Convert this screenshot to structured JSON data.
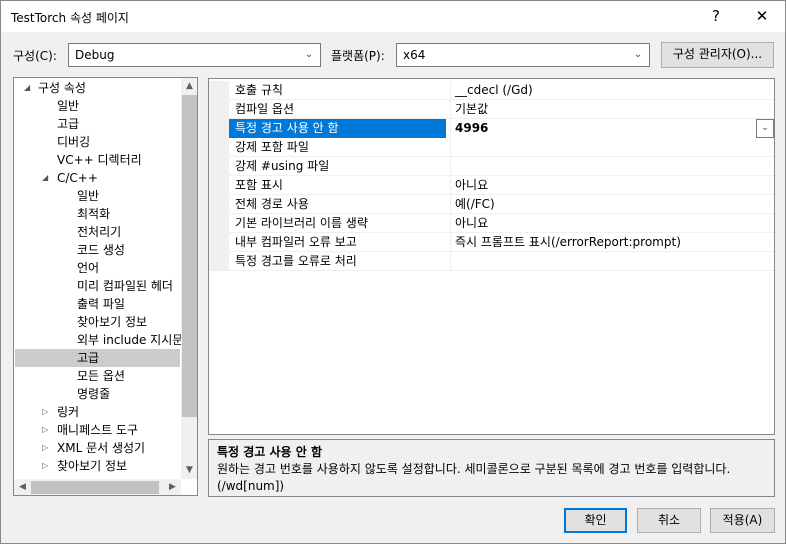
{
  "window": {
    "title": "TestTorch 속성 페이지",
    "help_glyph": "?",
    "close_glyph": "✕"
  },
  "config_bar": {
    "config_label": "구성(C):",
    "config_value": "Debug",
    "platform_label": "플랫폼(P):",
    "platform_value": "x64",
    "manager_button": "구성 관리자(O)..."
  },
  "tree": {
    "root": "구성 속성",
    "items": [
      {
        "label": "일반"
      },
      {
        "label": "고급"
      },
      {
        "label": "디버깅"
      },
      {
        "label": "VC++ 디렉터리"
      }
    ],
    "cpp_label": "C/C++",
    "cpp_items": [
      {
        "label": "일반"
      },
      {
        "label": "최적화"
      },
      {
        "label": "전처리기"
      },
      {
        "label": "코드 생성"
      },
      {
        "label": "언어"
      },
      {
        "label": "미리 컴파일된 헤더"
      },
      {
        "label": "출력 파일"
      },
      {
        "label": "찾아보기 정보"
      },
      {
        "label": "외부 include 지시문"
      },
      {
        "label": "고급"
      },
      {
        "label": "모든 옵션"
      },
      {
        "label": "명령줄"
      }
    ],
    "collapsed": [
      {
        "label": "링커"
      },
      {
        "label": "매니페스트 도구"
      },
      {
        "label": "XML 문서 생성기"
      },
      {
        "label": "찾아보기 정보"
      }
    ],
    "selected": "고급"
  },
  "properties": [
    {
      "name": "호출 규칙",
      "value": "__cdecl (/Gd)"
    },
    {
      "name": "컴파일 옵션",
      "value": "기본값"
    },
    {
      "name": "특정 경고 사용 안 함",
      "value": "4996"
    },
    {
      "name": "강제 포함 파일",
      "value": ""
    },
    {
      "name": "강제 #using 파일",
      "value": ""
    },
    {
      "name": "포함 표시",
      "value": "아니요"
    },
    {
      "name": "전체 경로 사용",
      "value": "예(/FC)"
    },
    {
      "name": "기본 라이브러리 이름 생략",
      "value": "아니요"
    },
    {
      "name": "내부 컴파일러 오류 보고",
      "value": "즉시 프롬프트 표시(/errorReport:prompt)"
    },
    {
      "name": "특정 경고를 오류로 처리",
      "value": ""
    }
  ],
  "description": {
    "title": "특정 경고 사용 안 함",
    "text": "원하는 경고 번호를 사용하지 않도록 설정합니다. 세미콜론으로 구분된 목록에 경고 번호를 입력합니다.     (/wd[num])"
  },
  "buttons": {
    "ok": "확인",
    "cancel": "취소",
    "apply": "적용(A)"
  },
  "colors": {
    "selection": "#0078d7",
    "tree_selection": "#cccccc"
  }
}
